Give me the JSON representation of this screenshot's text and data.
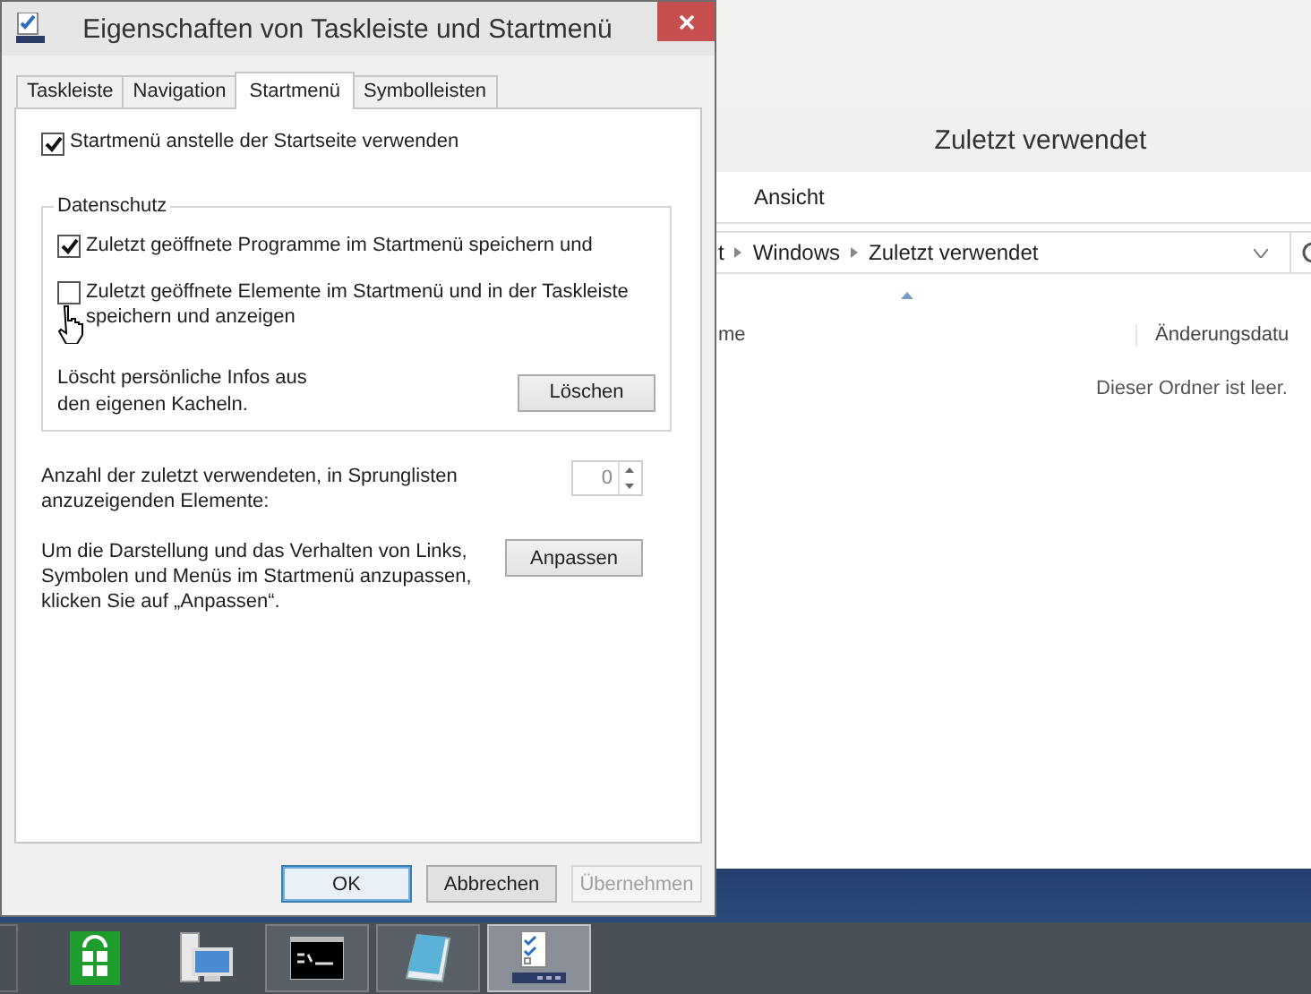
{
  "dialog": {
    "title": "Eigenschaften von Taskleiste und Startmenü",
    "tabs": [
      {
        "label": "Taskleiste",
        "selected": false
      },
      {
        "label": "Navigation",
        "selected": false
      },
      {
        "label": "Startmenü",
        "selected": true
      },
      {
        "label": "Symbolleisten",
        "selected": false
      }
    ],
    "use_start_menu": {
      "label": "Startmenü anstelle der Startseite verwenden",
      "checked": true
    },
    "privacy": {
      "legend": "Datenschutz",
      "options": [
        {
          "label": "Zuletzt geöffnete Programme im Startmenü speichern und",
          "checked": true
        },
        {
          "label": "Zuletzt geöffnete Elemente im Startmenü und in der Taskleiste speichern und anzeigen",
          "checked": false
        }
      ],
      "clear_text": "Löscht persönliche Infos aus den eigenen Kacheln.",
      "clear_button": "Löschen"
    },
    "jumplist": {
      "label": "Anzahl der zuletzt verwendeten, in Sprunglisten anzuzeigenden Elemente:",
      "value": "0"
    },
    "customize": {
      "text": "Um die Darstellung und das Verhalten von Links, Symbolen und Menüs im Startmenü anzupassen, klicken Sie auf „Anpassen“.",
      "button": "Anpassen"
    },
    "buttons": [
      {
        "label": "OK",
        "default": true,
        "disabled": false
      },
      {
        "label": "Abbrechen",
        "default": false,
        "disabled": false
      },
      {
        "label": "Übernehmen",
        "default": false,
        "disabled": true
      }
    ]
  },
  "explorer": {
    "title": "Zuletzt verwendet",
    "menu": [
      "Ansicht"
    ],
    "breadcrumb": [
      "t",
      "Windows",
      "Zuletzt verwendet"
    ],
    "columns": [
      "me",
      "Änderungsdatu"
    ],
    "empty_text": "Dieser Ordner ist leer."
  },
  "taskbar": {
    "items": [
      {
        "kind": "store",
        "running": false,
        "active": false
      },
      {
        "kind": "computer",
        "running": false,
        "active": false
      },
      {
        "kind": "console",
        "running": true,
        "active": false
      },
      {
        "kind": "notepad",
        "running": true,
        "active": false
      },
      {
        "kind": "checklist",
        "running": true,
        "active": true
      }
    ]
  }
}
